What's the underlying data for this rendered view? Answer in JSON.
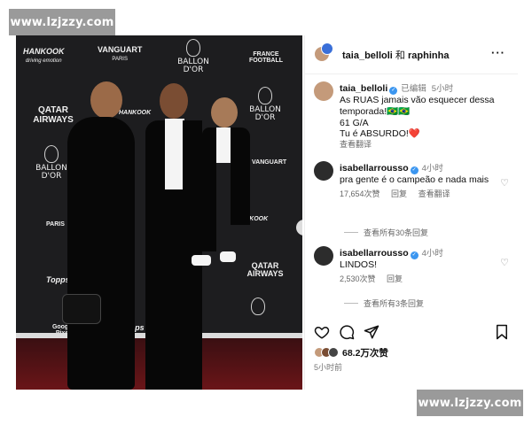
{
  "watermarks": {
    "top": "www.lzjzzy.com",
    "bottom": "www.lzjzzy.com"
  },
  "photo": {
    "sponsors": {
      "hankook_1": "HANKOOK",
      "hankook_sub": "driving emotion",
      "vanguart": "VANGUART",
      "vanguart_sub": "PARIS",
      "ballon_1": "BALLON D'OR",
      "france_football": "FRANCE FOOTBALL",
      "qatar_1": "QATAR AIRWAYS",
      "hankook_2": "HANKOOK",
      "ballon_2": "BALLON D'OR",
      "ballon_3": "BALLON D'OR",
      "vanguart_2": "VANGUART",
      "paris": "PARIS",
      "hankook_3": "HANKOOK",
      "qatar_2": "QATAR AIRWAYS",
      "topps_1": "Topps",
      "topps_2": "Topps",
      "google": "Google Pixel"
    },
    "carousel_next": "›"
  },
  "header": {
    "user1": "taia_belloli",
    "conj": "和",
    "user2": "raphinha",
    "more": "···"
  },
  "comments": [
    {
      "user": "taia_belloli",
      "edited": "已编辑",
      "time": "5小时",
      "lines": [
        "As RUAS jamais vão esquecer dessa",
        "temporada!🇧🇷🇧🇷",
        "61 G/A",
        "Tu é ABSURDO!❤️"
      ],
      "translate": "查看翻译"
    },
    {
      "user": "isabellarrousso",
      "time": "4小时",
      "text": "pra gente é o campeão e nada mais",
      "likes": "17,654次赞",
      "reply": "回复",
      "translate": "查看翻译",
      "view_replies": "查看所有30条回复"
    },
    {
      "user": "isabellarrousso",
      "time": "4小时",
      "text": "LINDOS!",
      "likes": "2,530次赞",
      "reply": "回复",
      "view_replies": "查看所有3条回复"
    }
  ],
  "actions": {
    "like_icon": "heart-icon",
    "comment_icon": "comment-icon",
    "share_icon": "share-icon",
    "save_icon": "bookmark-icon"
  },
  "likes_total": "68.2万次赞",
  "posted_ago": "5小时前",
  "colors": {
    "verified": "#3b96f0",
    "watermark": "#9a9a9a"
  }
}
